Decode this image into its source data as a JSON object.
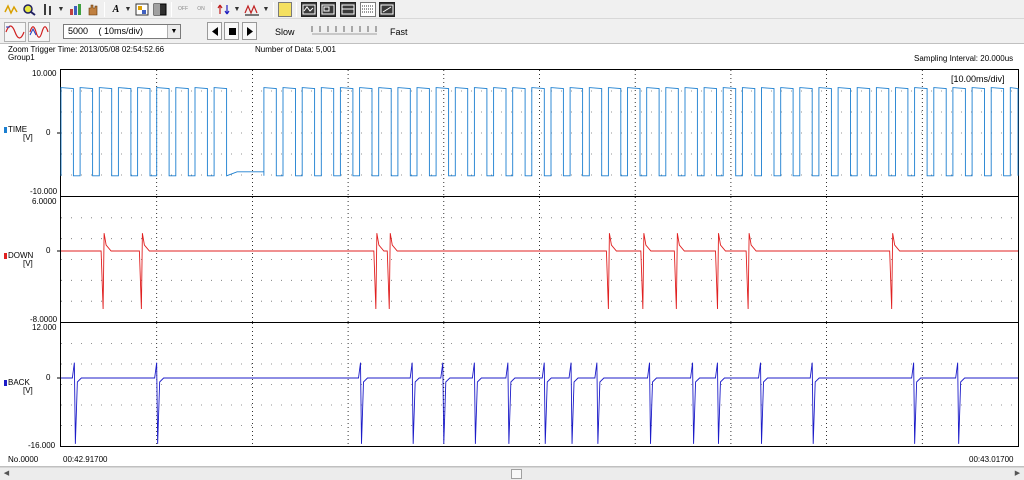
{
  "toolbar": {
    "icons": [
      "star-waveform-icon",
      "magnifier-icon",
      "cursor-icon",
      "chart-icon",
      "hand-icon",
      "text-icon",
      "color-icon",
      "black-square-icon",
      "on-off-icon",
      "zoom-arrows-icon",
      "measure-icon",
      "calculator-icon",
      "window-1-icon",
      "window-2-icon",
      "window-3-icon",
      "window-4-icon",
      "window-5-icon",
      "window-6-icon"
    ],
    "text_glyph": "A",
    "off_label_1": "OFF",
    "off_label_2": "ON"
  },
  "controls": {
    "data_select": {
      "value": "5000",
      "unit": "( 10ms/div)"
    },
    "slow_label": "Slow",
    "fast_label": "Fast"
  },
  "header": {
    "trigger_time": "Zoom Trigger Time: 2013/05/08 02:54:52.66",
    "group": "Group1",
    "number_of_data": "Number of Data: 5,001",
    "sampling_interval": "Sampling Interval:  20.000us",
    "time_div": "[10.00ms/div]"
  },
  "channels": [
    {
      "name": "TIME",
      "unit": "[V]",
      "top": "10.000",
      "zero": "0",
      "bottom": "-10.000",
      "color": "#1c7fd0",
      "type": "square"
    },
    {
      "name": "DOWN",
      "unit": "[V]",
      "top": "6.0000",
      "zero": "0",
      "bottom": "-8.0000",
      "color": "#e02020",
      "type": "down_spikes",
      "spike_times_ms": [
        4.4,
        8.4,
        32.9,
        34.3,
        57.2,
        60.8,
        64.3,
        68.6,
        71.8,
        86.8
      ]
    },
    {
      "name": "BACK",
      "unit": "[V]",
      "top": "12.000",
      "zero": "0",
      "bottom": "-16.000",
      "color": "#1c1cc8",
      "type": "back_spikes",
      "spike_times_ms": [
        1.5,
        10.1,
        31.4,
        36.8,
        40.0,
        43.3,
        46.8,
        50.6,
        53.4,
        56.1,
        61.6,
        66.1,
        68.7,
        73.2,
        78.6,
        89.2,
        93.8
      ]
    }
  ],
  "footer": {
    "no": "No.0000",
    "start_time": "00:42.91700",
    "end_time": "00:43.01700"
  },
  "colors": {
    "grid_dot": "#707070",
    "frame": "#000000"
  }
}
